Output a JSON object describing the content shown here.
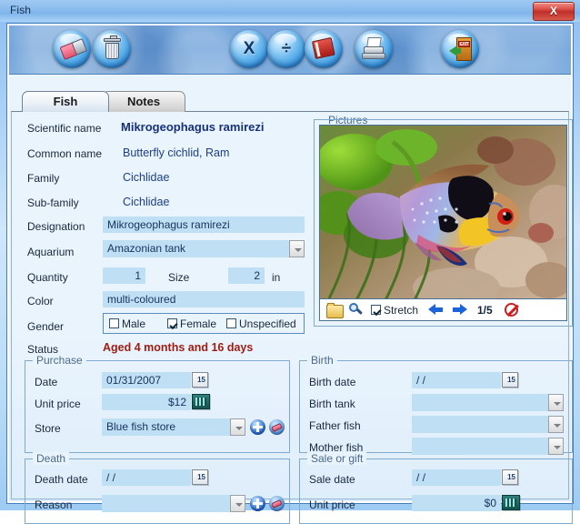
{
  "window": {
    "title": "Fish",
    "close_label": "X"
  },
  "toolbar": {
    "buttons": [
      {
        "name": "clear-button",
        "icon": "eraser-icon"
      },
      {
        "name": "delete-button",
        "icon": "trash-icon"
      },
      {
        "name": "multiply-button",
        "icon": "multiply-icon",
        "glyph": "X"
      },
      {
        "name": "divide-button",
        "icon": "divide-icon",
        "glyph": "÷"
      },
      {
        "name": "catalog-button",
        "icon": "book-icon"
      },
      {
        "name": "print-button",
        "icon": "printer-icon"
      },
      {
        "name": "exit-button",
        "icon": "exit-door-icon",
        "glyph": "EXIT"
      }
    ]
  },
  "tabs": [
    {
      "label": "Fish",
      "active": true
    },
    {
      "label": "Notes",
      "active": false
    }
  ],
  "form": {
    "scientific_name": {
      "label": "Scientific name",
      "value": "Mikrogeophagus ramirezi"
    },
    "common_name": {
      "label": "Common name",
      "value": "Butterfly cichlid, Ram"
    },
    "family": {
      "label": "Family",
      "value": "Cichlidae"
    },
    "sub_family": {
      "label": "Sub-family",
      "value": "Cichlidae"
    },
    "designation": {
      "label": "Designation",
      "value": "Mikrogeophagus ramirezi"
    },
    "aquarium": {
      "label": "Aquarium",
      "value": "Amazonian tank"
    },
    "quantity": {
      "label": "Quantity",
      "value": "1"
    },
    "size": {
      "label": "Size",
      "value": "2",
      "unit": "in"
    },
    "color": {
      "label": "Color",
      "value": "multi-coloured"
    },
    "gender": {
      "label": "Gender",
      "options": [
        {
          "label": "Male",
          "checked": false
        },
        {
          "label": "Female",
          "checked": true
        },
        {
          "label": "Unspecified",
          "checked": false
        }
      ]
    },
    "status": {
      "label": "Status",
      "value": "Aged 4 months and 16 days",
      "color": "#9e1b10"
    }
  },
  "pictures": {
    "title": "Pictures",
    "stretch_label": "Stretch",
    "stretch_checked": true,
    "counter": "1/5",
    "icons": [
      "folder-icon",
      "magnifier-icon",
      "previous-arrow-icon",
      "next-arrow-icon",
      "forbidden-icon"
    ]
  },
  "purchase": {
    "title": "Purchase",
    "date": {
      "label": "Date",
      "value": "01/31/2007"
    },
    "unit_price": {
      "label": "Unit price",
      "value": "$12"
    },
    "store": {
      "label": "Store",
      "value": "Blue fish store"
    }
  },
  "birth": {
    "title": "Birth",
    "birth_date": {
      "label": "Birth date",
      "value": "  /  /"
    },
    "birth_tank": {
      "label": "Birth tank",
      "value": ""
    },
    "father_fish": {
      "label": "Father fish",
      "value": ""
    },
    "mother_fish": {
      "label": "Mother fish",
      "value": ""
    }
  },
  "death": {
    "title": "Death",
    "death_date": {
      "label": "Death date",
      "value": "  /  /"
    },
    "reason": {
      "label": "Reason",
      "value": ""
    }
  },
  "sale": {
    "title": "Sale or gift",
    "sale_date": {
      "label": "Sale date",
      "value": "  /  /"
    },
    "unit_price": {
      "label": "Unit price",
      "value": "$0"
    }
  }
}
